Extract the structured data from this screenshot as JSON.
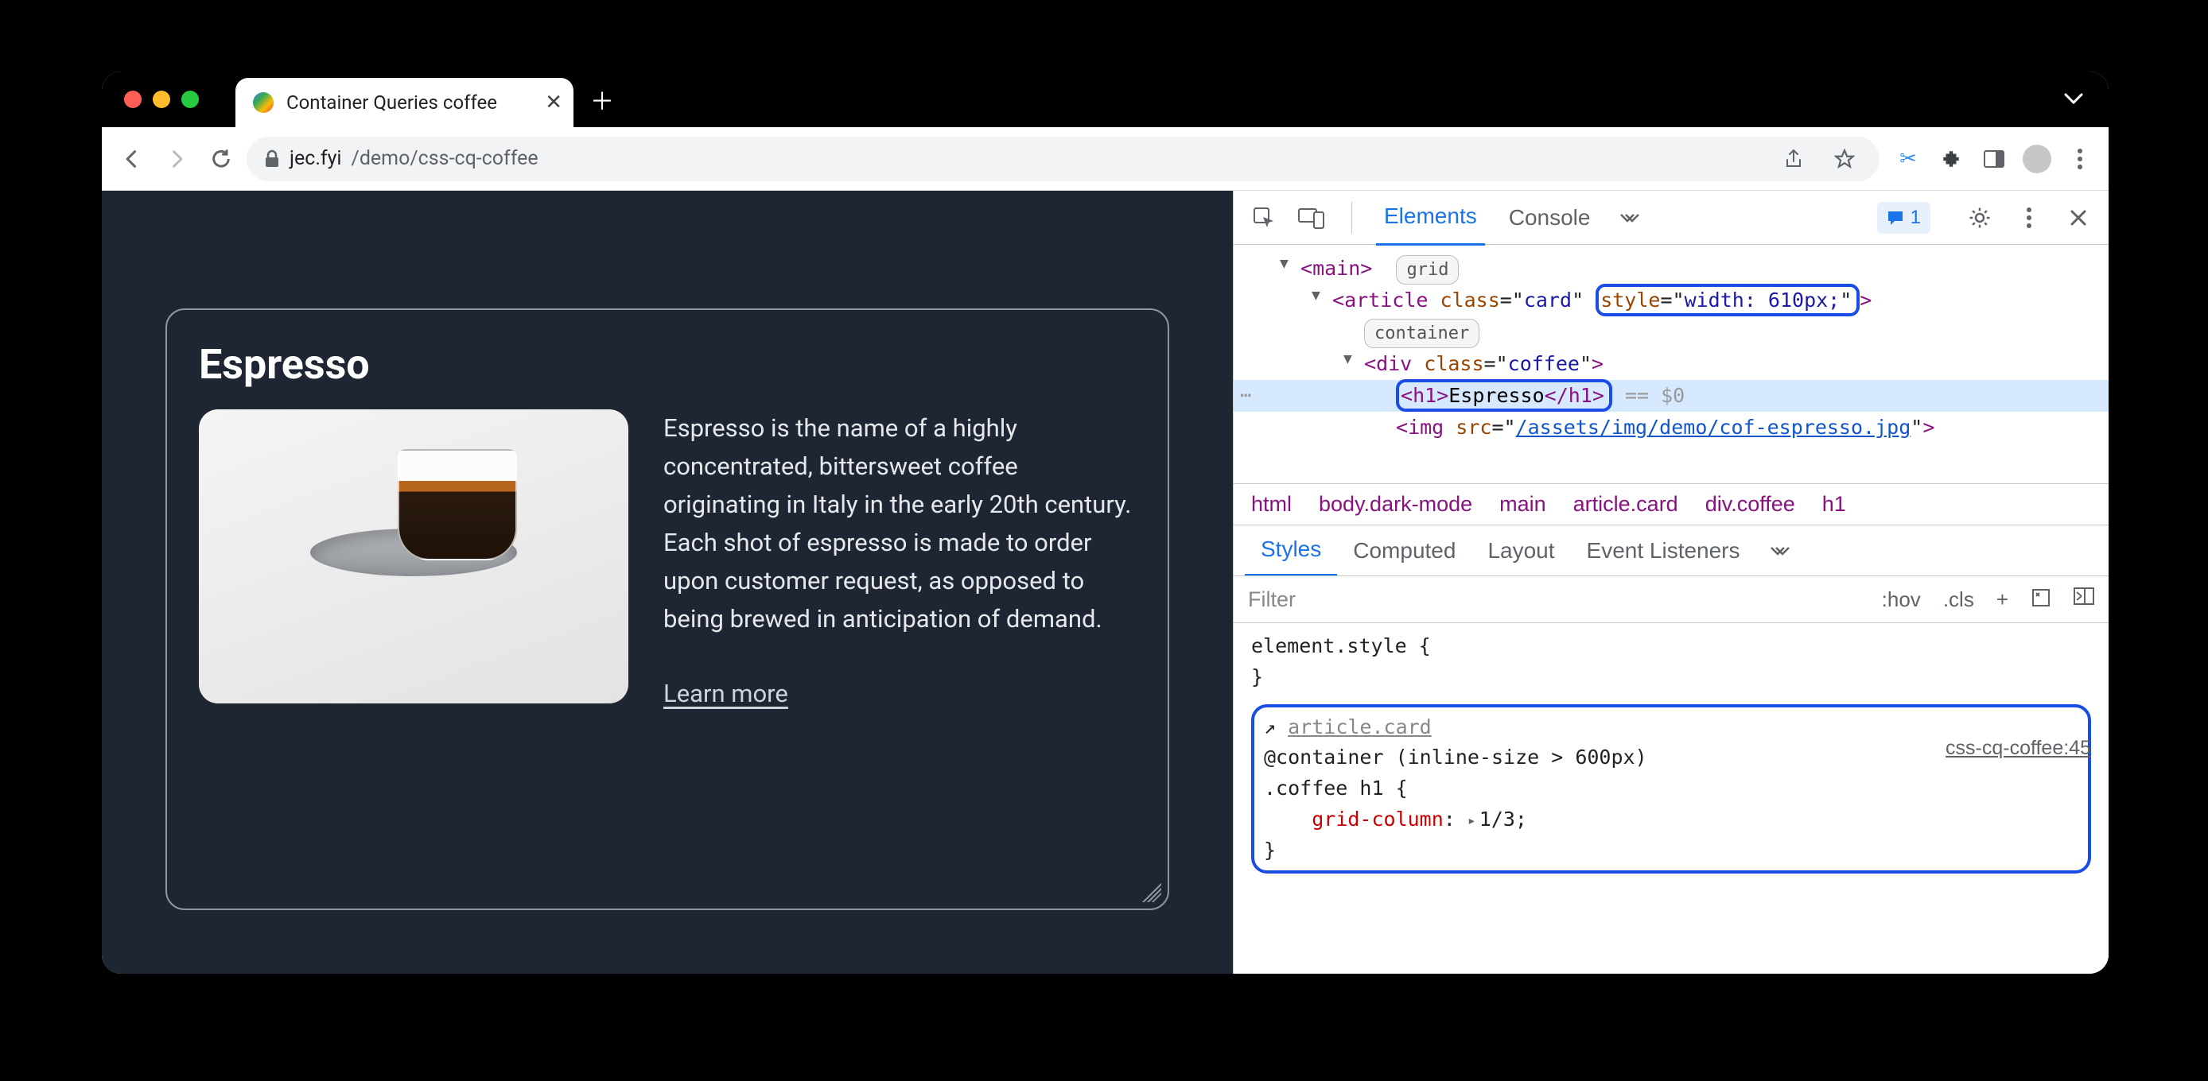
{
  "browser": {
    "tab_title": "Container Queries coffee",
    "url_host": "jec.fyi",
    "url_path": "/demo/css-cq-coffee"
  },
  "page": {
    "heading": "Espresso",
    "body_text": "Espresso is the name of a highly concentrated, bittersweet coffee originating in Italy in the early 20th century. Each shot of espresso is made to order upon customer request, as opposed to being brewed in anticipation of demand.",
    "learn_more": "Learn more"
  },
  "devtools": {
    "tabs": {
      "elements": "Elements",
      "console": "Console"
    },
    "issues_count": "1",
    "dom": {
      "main_open": "main",
      "badge_grid": "grid",
      "article_open": "article",
      "article_class_attr": "class",
      "article_class_val": "card",
      "article_style_attr": "style",
      "article_style_val": "width: 610px;",
      "badge_container": "container",
      "div_open": "div",
      "div_class_attr": "class",
      "div_class_val": "coffee",
      "h1_open": "h1",
      "h1_text": "Espresso",
      "h1_close": "h1",
      "eq0": "== $0",
      "img_open": "img",
      "img_src_attr": "src",
      "img_src_val": "/assets/img/demo/cof-espresso.jpg"
    },
    "breadcrumb": [
      "html",
      "body.dark-mode",
      "main",
      "article.card",
      "div.coffee",
      "h1"
    ],
    "styles_tabs": {
      "styles": "Styles",
      "computed": "Computed",
      "layout": "Layout",
      "event_listeners": "Event Listeners"
    },
    "filter_placeholder": "Filter",
    "filter_actions": {
      "hov": ":hov",
      "cls": ".cls",
      "plus": "+"
    },
    "rules": {
      "element_style": "element.style",
      "container_target": "article.card",
      "container_query": "@container (inline-size > 600px)",
      "selector": ".coffee h1",
      "prop": "grid-column",
      "val": "1/3",
      "source": "css-cq-coffee:45"
    }
  }
}
